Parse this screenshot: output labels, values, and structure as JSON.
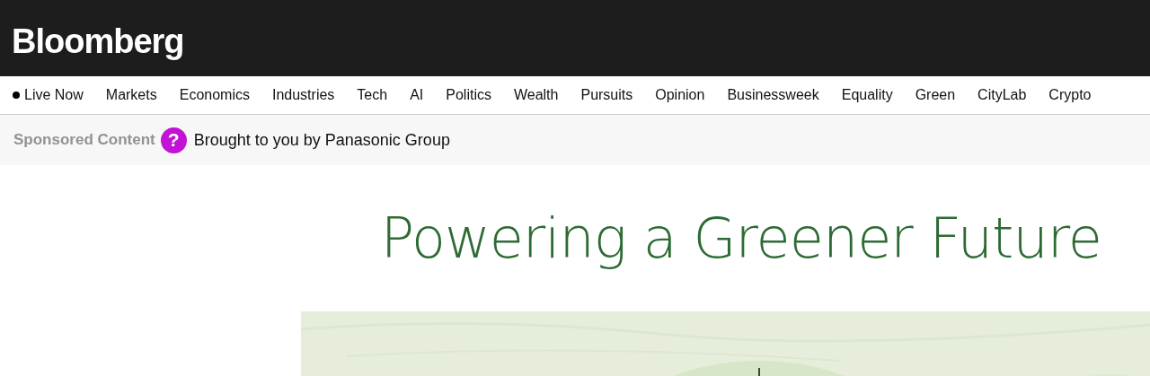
{
  "header": {
    "logo": "Bloomberg"
  },
  "nav": {
    "items": [
      {
        "label": "Live Now",
        "kind": "live"
      },
      {
        "label": "Markets",
        "kind": "link"
      },
      {
        "label": "Economics",
        "kind": "link"
      },
      {
        "label": "Industries",
        "kind": "link"
      },
      {
        "label": "Tech",
        "kind": "link"
      },
      {
        "label": "AI",
        "kind": "link"
      },
      {
        "label": "Politics",
        "kind": "link"
      },
      {
        "label": "Wealth",
        "kind": "link"
      },
      {
        "label": "Pursuits",
        "kind": "link"
      },
      {
        "label": "Opinion",
        "kind": "link"
      },
      {
        "label": "Businessweek",
        "kind": "link"
      },
      {
        "label": "Equality",
        "kind": "link"
      },
      {
        "label": "Green",
        "kind": "link"
      },
      {
        "label": "CityLab",
        "kind": "link"
      },
      {
        "label": "Crypto",
        "kind": "link"
      }
    ]
  },
  "sponsor_bar": {
    "label": "Sponsored Content",
    "help_icon": "?",
    "text": "Brought to you by Panasonic Group"
  },
  "article": {
    "title": "Powering a Greener Future"
  }
}
